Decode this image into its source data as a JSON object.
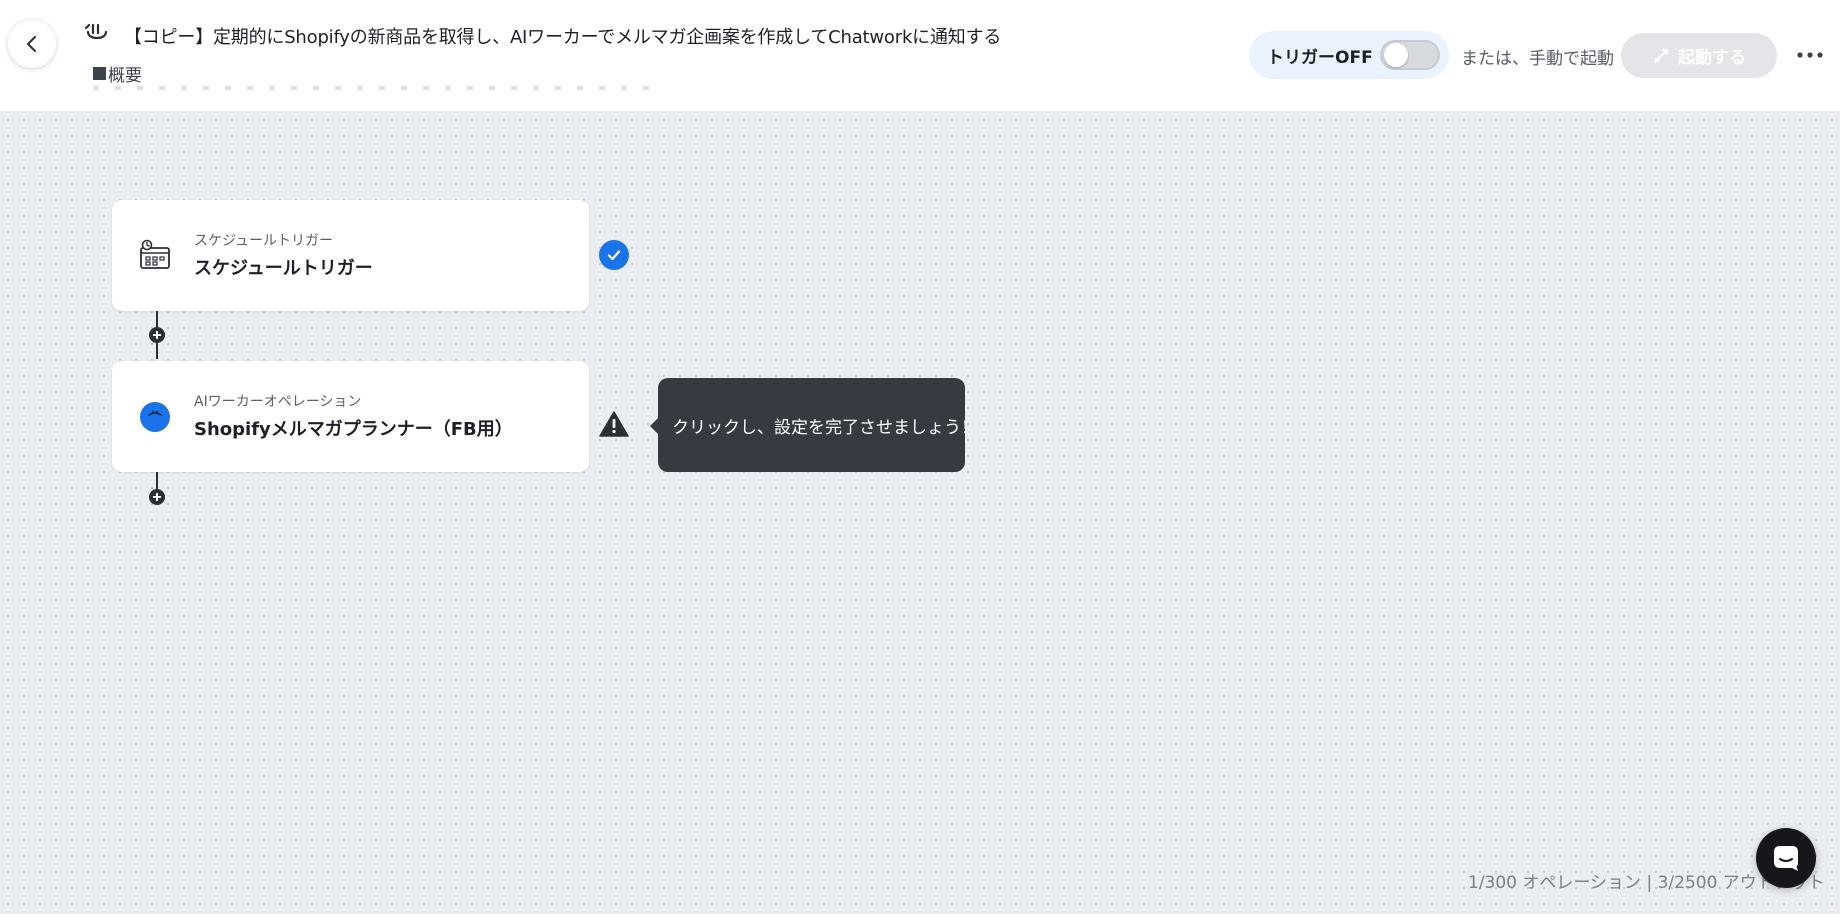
{
  "header": {
    "title": "【コピー】定期的にShopifyの新商品を取得し、AIワーカーでメルマガ企画案を作成してChatworkに通知する",
    "description_heading": "概要",
    "trigger_label": "トリガーOFF",
    "trigger_on": false,
    "manual_label": "または、手動で起動",
    "launch_label": "起動する",
    "icons": {
      "back": "chevron-left-icon",
      "flow": "flow-icon",
      "launch": "launch-icon",
      "more": "more-dots-icon"
    }
  },
  "flow": {
    "steps": [
      {
        "type_label": "スケジュールトリガー",
        "title": "スケジュールトリガー",
        "icon": "calendar-clock-icon",
        "status": "complete",
        "status_icon": "check-icon"
      },
      {
        "type_label": "AIワーカーオペレーション",
        "title": "Shopifyメルマガプランナー（FB用）",
        "icon": "ai-worker-icon",
        "status": "warning",
        "status_icon": "warning-icon",
        "tooltip": "クリックし、設定を完了させましょう！"
      }
    ]
  },
  "footer": {
    "usage": "1/300 オペレーション | 3/2500 アウトプット",
    "chat_icon": "chat-icon"
  },
  "colors": {
    "accent": "#1a73e8",
    "canvas": "#eaedf1",
    "tooltip": "#363a41",
    "trigger_pill": "#eaf3fd"
  }
}
